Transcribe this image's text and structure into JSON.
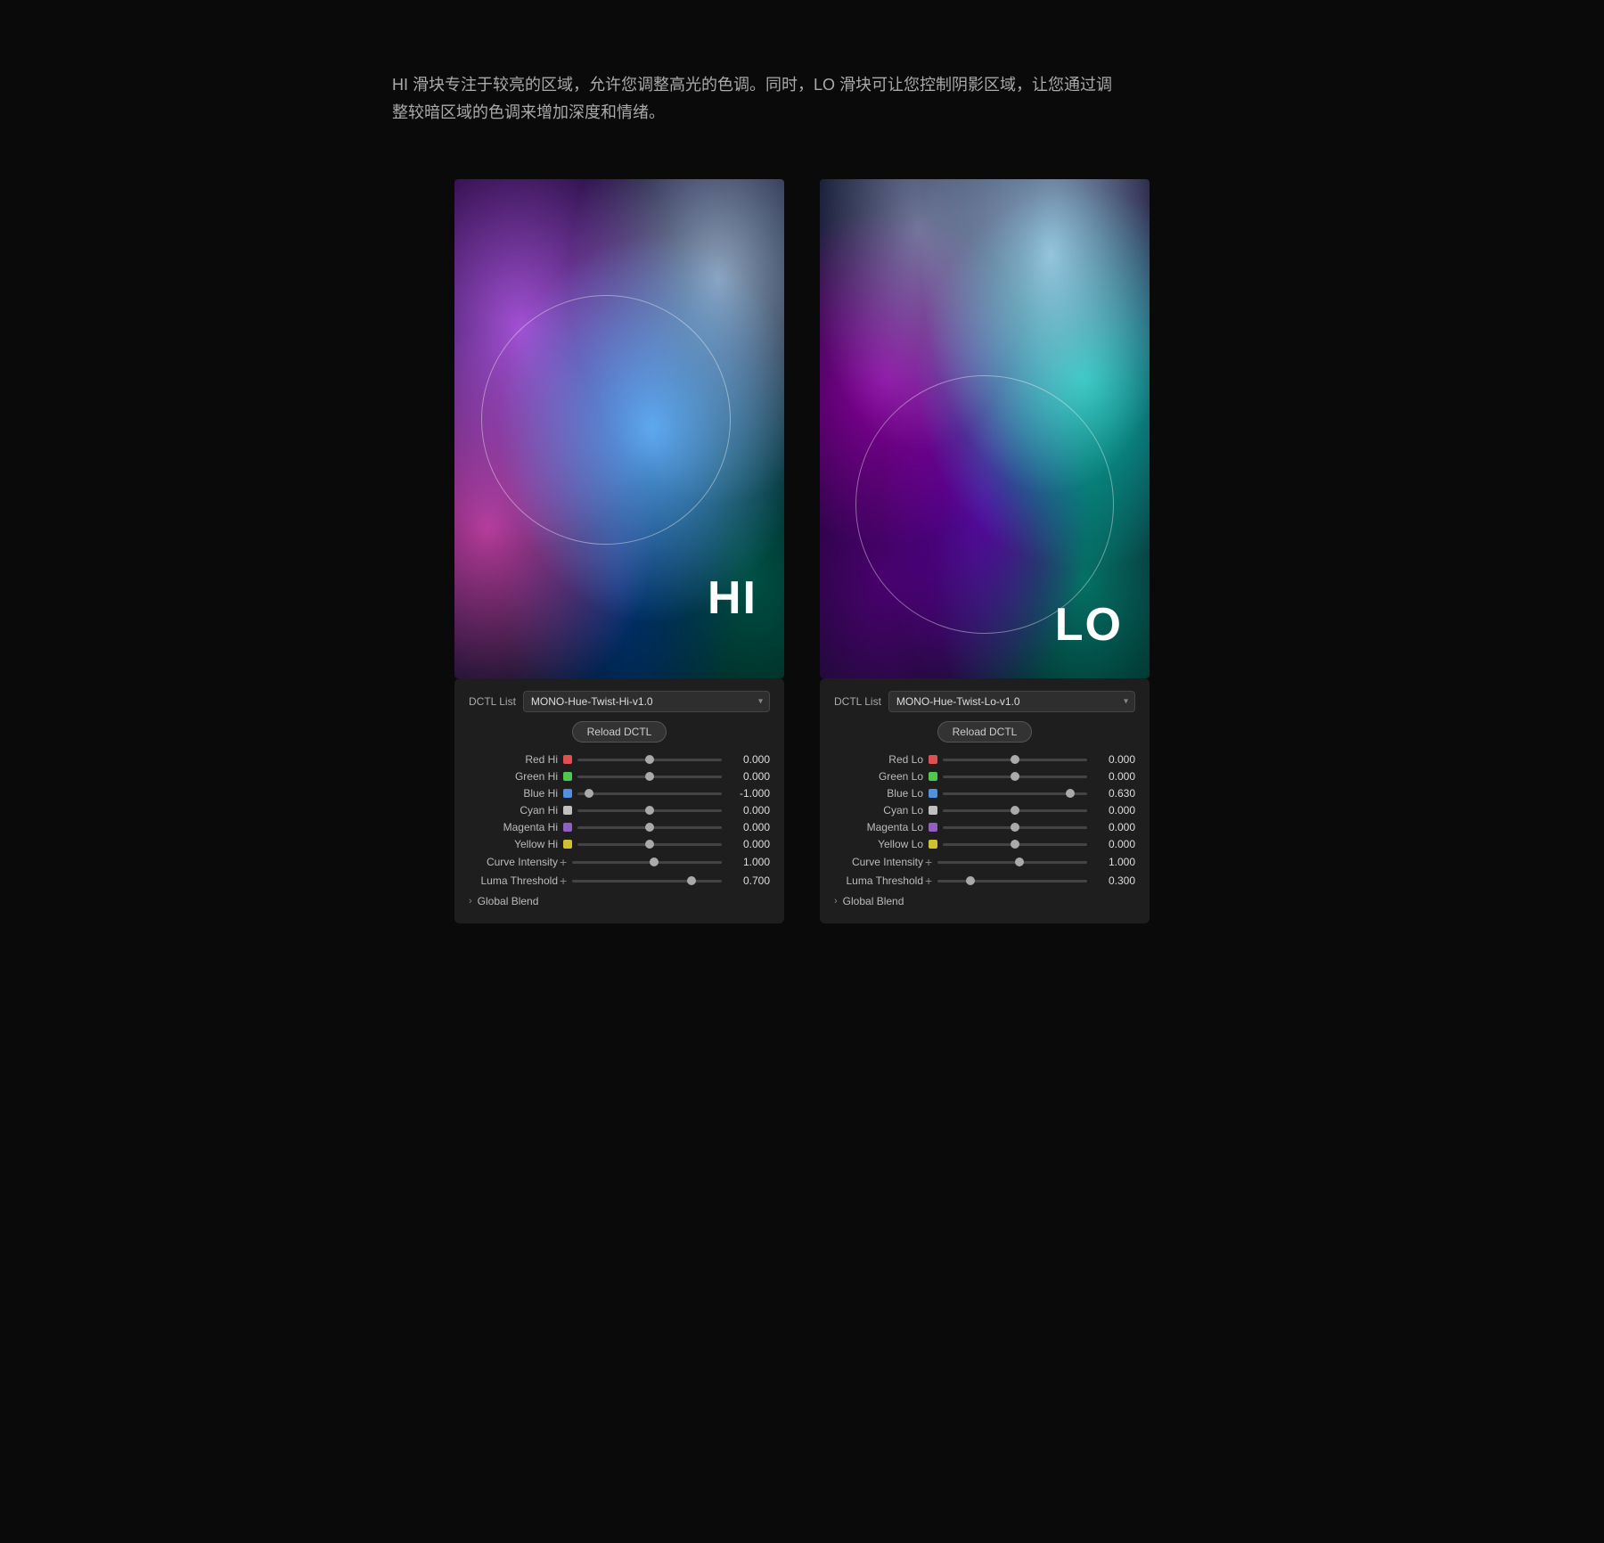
{
  "description": "HI 滑块专注于较亮的区域，允许您调整高光的色调。同时，LO 滑块可让您控制阴影区域，让您通过调整较暗区域的色调来增加深度和情绪。",
  "hi_panel": {
    "preview_label": "HI",
    "dctl_list_label": "DCTL List",
    "dctl_value": "MONO-Hue-Twist-Hi-v1.0",
    "reload_label": "Reload DCTL",
    "params": [
      {
        "label": "Red Hi",
        "color": "#e05050",
        "thumb_pct": 50,
        "value": "0.000"
      },
      {
        "label": "Green Hi",
        "color": "#50c850",
        "thumb_pct": 50,
        "value": "0.000"
      },
      {
        "label": "Blue Hi",
        "color": "#5090e0",
        "thumb_pct": 8,
        "value": "-1.000"
      },
      {
        "label": "Cyan Hi",
        "color": "#c0c0c0",
        "thumb_pct": 50,
        "value": "0.000"
      },
      {
        "label": "Magenta Hi",
        "color": "#9060c0",
        "thumb_pct": 50,
        "value": "0.000"
      },
      {
        "label": "Yellow Hi",
        "color": "#d0c030",
        "thumb_pct": 50,
        "value": "0.000"
      },
      {
        "label": "Curve Intensity",
        "plus": true,
        "thumb_pct": 55,
        "value": "1.000"
      },
      {
        "label": "Luma Threshold",
        "plus": true,
        "thumb_pct": 80,
        "value": "0.700"
      }
    ],
    "global_blend": "Global Blend"
  },
  "lo_panel": {
    "preview_label": "LO",
    "dctl_list_label": "DCTL List",
    "dctl_value": "MONO-Hue-Twist-Lo-v1.0",
    "reload_label": "Reload DCTL",
    "params": [
      {
        "label": "Red Lo",
        "color": "#e05050",
        "thumb_pct": 50,
        "value": "0.000"
      },
      {
        "label": "Green Lo",
        "color": "#50c850",
        "thumb_pct": 50,
        "value": "0.000"
      },
      {
        "label": "Blue Lo",
        "color": "#5090e0",
        "thumb_pct": 88,
        "value": "0.630"
      },
      {
        "label": "Cyan Lo",
        "color": "#c0c0c0",
        "thumb_pct": 50,
        "value": "0.000"
      },
      {
        "label": "Magenta Lo",
        "color": "#9060c0",
        "thumb_pct": 50,
        "value": "0.000"
      },
      {
        "label": "Yellow Lo",
        "color": "#d0c030",
        "thumb_pct": 50,
        "value": "0.000"
      },
      {
        "label": "Curve Intensity",
        "plus": true,
        "thumb_pct": 55,
        "value": "1.000"
      },
      {
        "label": "Luma Threshold",
        "plus": true,
        "thumb_pct": 22,
        "value": "0.300"
      }
    ],
    "global_blend": "Global Blend"
  }
}
